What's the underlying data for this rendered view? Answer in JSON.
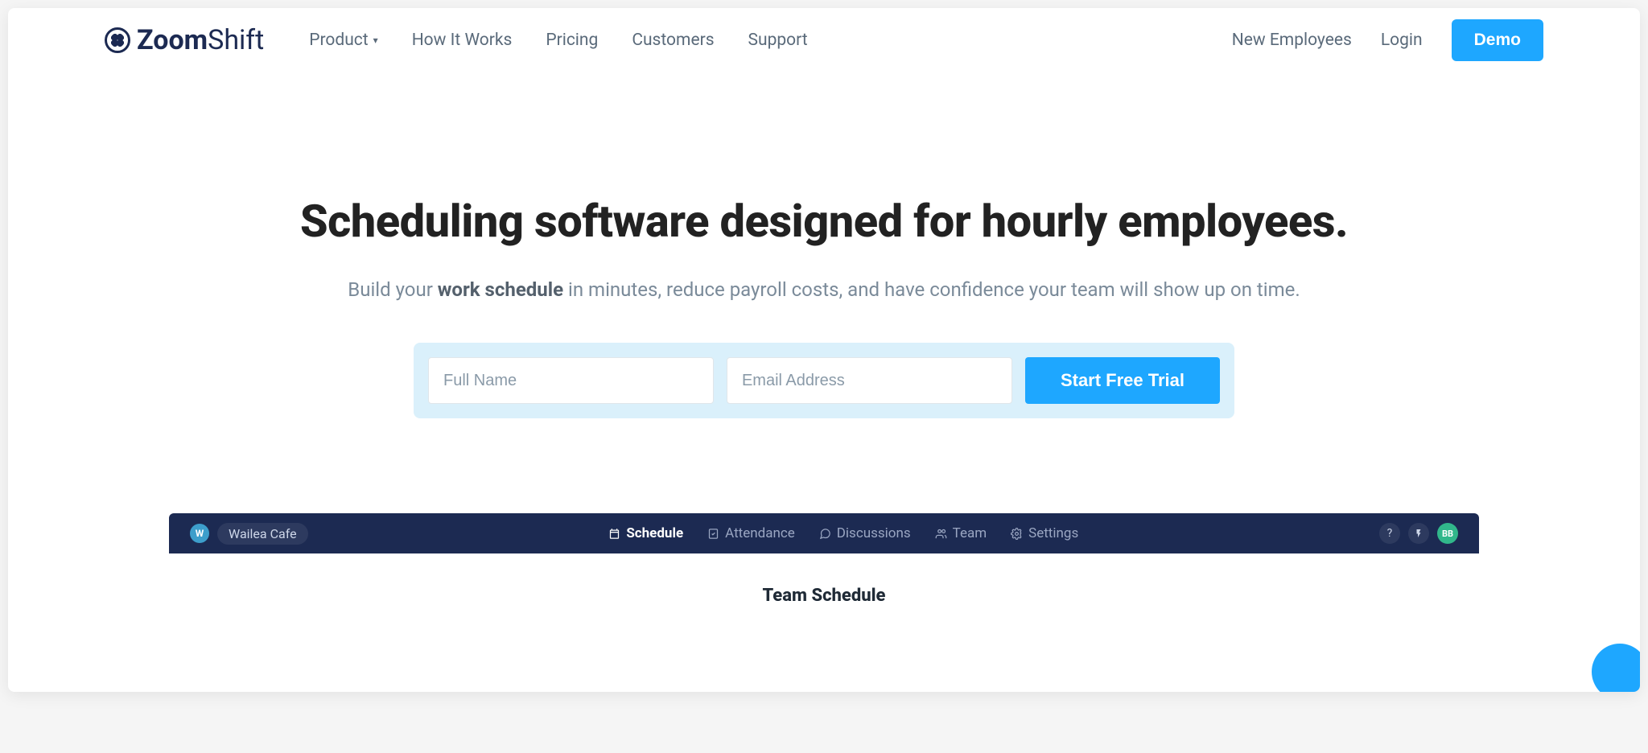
{
  "logo": {
    "bold": "Zoom",
    "thin": "Shift"
  },
  "nav": {
    "items": [
      {
        "label": "Product",
        "dropdown": true
      },
      {
        "label": "How It Works",
        "dropdown": false
      },
      {
        "label": "Pricing",
        "dropdown": false
      },
      {
        "label": "Customers",
        "dropdown": false
      },
      {
        "label": "Support",
        "dropdown": false
      }
    ],
    "right": {
      "new_employees": "New Employees",
      "login": "Login",
      "demo": "Demo"
    }
  },
  "hero": {
    "headline": "Scheduling software designed for hourly employees.",
    "sub_before": "Build your ",
    "sub_bold": "work schedule",
    "sub_after": " in minutes, reduce payroll costs, and have confidence your team will show up on time."
  },
  "signup": {
    "name_placeholder": "Full Name",
    "email_placeholder": "Email Address",
    "cta": "Start Free Trial"
  },
  "app": {
    "avatar_letter": "W",
    "workspace": "Wailea Cafe",
    "tabs": [
      {
        "label": "Schedule",
        "active": true
      },
      {
        "label": "Attendance",
        "active": false
      },
      {
        "label": "Discussions",
        "active": false
      },
      {
        "label": "Team",
        "active": false
      },
      {
        "label": "Settings",
        "active": false
      }
    ],
    "right_badge": "BB",
    "sub_heading": "Team Schedule"
  }
}
